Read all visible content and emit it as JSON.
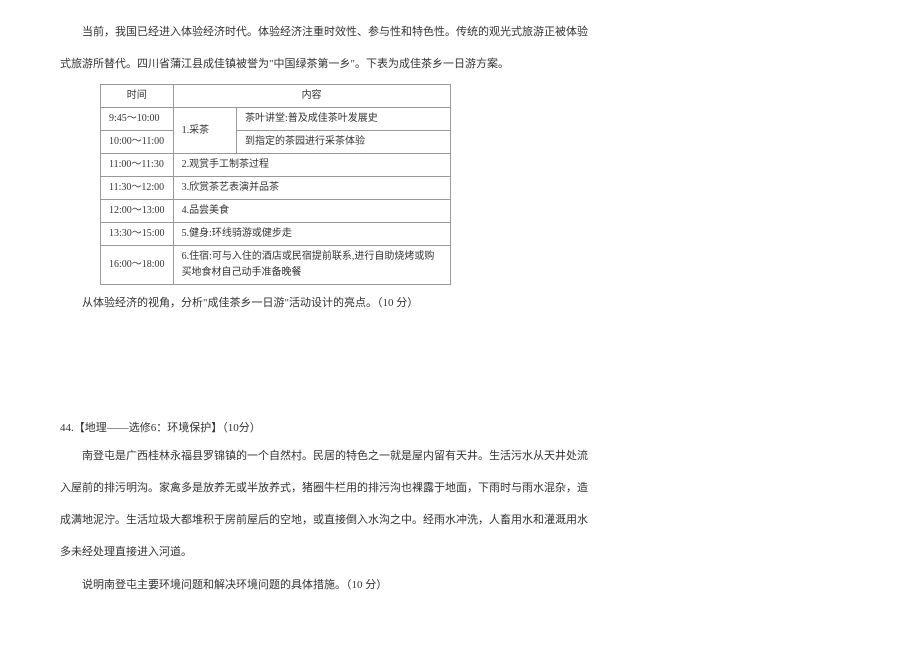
{
  "intro": {
    "line1": "当前，我国已经进入体验经济时代。体验经济注重时效性、参与性和特色性。传统的观光式旅游正被体验",
    "line2": "式旅游所替代。四川省蒲江县成佳镇被誉为\"中国绿茶第一乡\"。下表为成佳茶乡一日游方案。"
  },
  "table": {
    "headers": {
      "time": "时间",
      "content": "内容"
    },
    "rows": [
      {
        "time": "9:45～10:00",
        "item_merge": "1.采茶",
        "desc": "茶叶讲堂:普及成佳茶叶发展史"
      },
      {
        "time": "10:00～11:00",
        "desc": "到指定的茶园进行采茶体验"
      },
      {
        "time": "11:00～11:30",
        "full": "2.观赏手工制茶过程"
      },
      {
        "time": "11:30～12:00",
        "full": "3.欣赏茶艺表演并品茶"
      },
      {
        "time": "12:00～13:00",
        "full": "4.品尝美食"
      },
      {
        "time": "13:30～15:00",
        "full": "5.健身:环线骑游或健步走"
      },
      {
        "time": "16:00～18:00",
        "full": "6.住宿:可与入住的酒店或民宿提前联系,进行自助烧烤或购\n买地食材自己动手准备晚餐"
      }
    ]
  },
  "question43_tail": "从体验经济的视角，分析\"成佳茶乡一日游\"活动设计的亮点。（10 分）",
  "q44": {
    "title": "44.【地理——选修6：环境保护】（10分）",
    "line1": "南登屯是广西桂林永福县罗锦镇的一个自然村。民居的特色之一就是屋内留有天井。生活污水从天井处流",
    "line2": "入屋前的排污明沟。家禽多是放养无或半放养式，猪圈牛栏用的排污沟也裸露于地面，下雨时与雨水混杂，造",
    "line3": "成满地泥泞。生活垃圾大都堆积于房前屋后的空地，或直接倒入水沟之中。经雨水冲洗，人畜用水和灌溉用水",
    "line4": "多未经处理直接进入河道。",
    "ask": "说明南登屯主要环境问题和解决环境问题的具体措施。（10 分）"
  }
}
